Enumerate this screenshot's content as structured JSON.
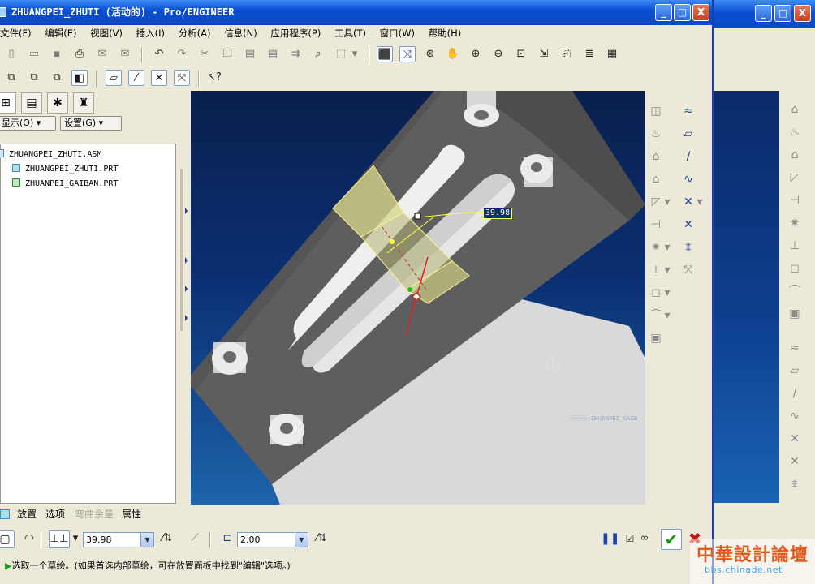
{
  "window": {
    "title": "ZHUANGPEI_ZHUTI (活动的) - Pro/ENGINEER",
    "minimize": "_",
    "maximize": "□",
    "close": "X"
  },
  "menu": [
    "文件(F)",
    "编辑(E)",
    "视图(V)",
    "插入(I)",
    "分析(A)",
    "信息(N)",
    "应用程序(P)",
    "工具(T)",
    "窗口(W)",
    "帮助(H)"
  ],
  "model_tree": {
    "show_button": "显示(O)",
    "settings_button": "设置(G)",
    "items": [
      {
        "label": "ZHUANGPEI_ZHUTI.ASM",
        "type": "assembly"
      },
      {
        "label": "ZHUANGPEI_ZHUTI.PRT",
        "type": "part"
      },
      {
        "label": "ZHUANPEI_GAIBAN.PRT",
        "type": "part-active"
      }
    ]
  },
  "viewport": {
    "dimension_value": "39.98",
    "model_label": "㊀㊀㊀:ZHUANPEI_GAIB"
  },
  "dashboard": {
    "tabs": [
      "放置",
      "选项",
      "弯曲余量",
      "属性"
    ],
    "disabled_tab": "弯曲余量",
    "length_value": "39.98",
    "thickness_value": "2.00"
  },
  "message": "选取一个草绘。(如果首选内部草绘，可在放置面板中找到\"编辑\"选项。)",
  "watermark": {
    "title": "中華設計論壇",
    "url": "bbs.chinade.net"
  },
  "colors": {
    "title_bar": "#0a4fd1",
    "viewport_top": "#0a1f4d",
    "viewport_bottom": "#1d64aa",
    "model_gray": "#5e5e5e",
    "model_light": "#d9d9d9",
    "preview_yellow": "#d8d88a",
    "confirm_green": "#1a9a1a",
    "cancel_red": "#cc1010"
  }
}
